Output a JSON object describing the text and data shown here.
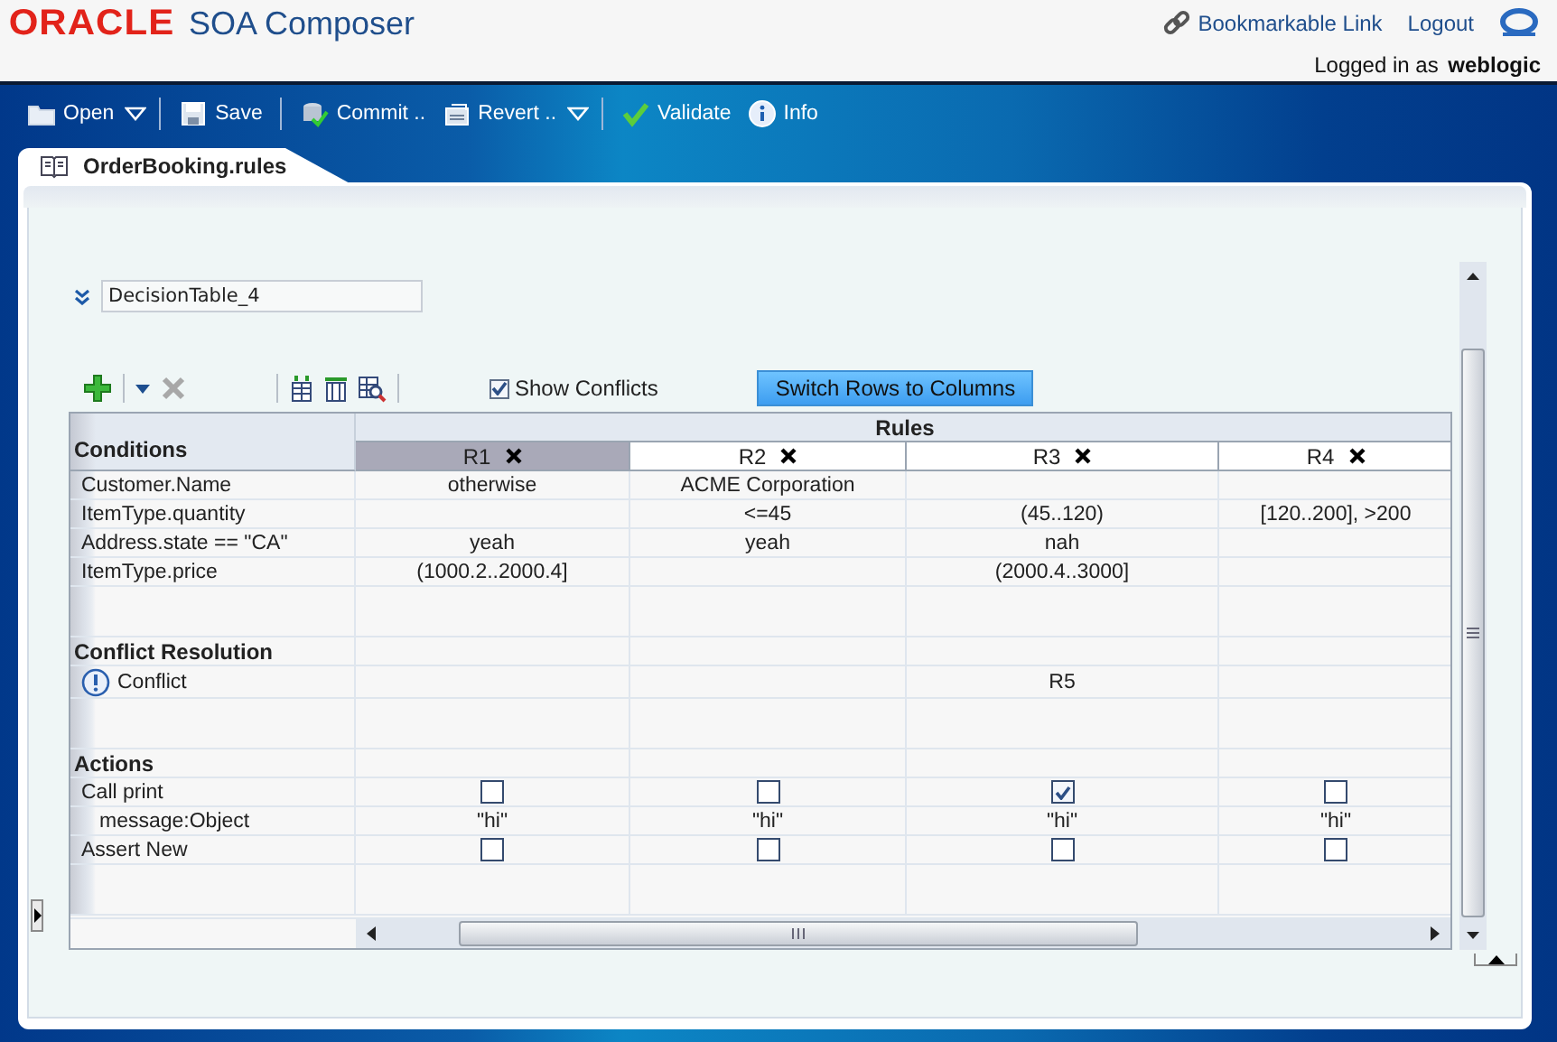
{
  "header": {
    "brand": "ORACLE",
    "product": "SOA Composer",
    "links": [
      {
        "label": "Bookmarkable Link",
        "kind": "bookmark"
      },
      {
        "label": "Logout",
        "kind": "plain"
      }
    ],
    "login": "Logged in as **weblogic**"
  },
  "toolbar": [
    {
      "label": "Open",
      "kind": "open",
      "dropdown": true,
      "separator_after": true
    },
    {
      "label": "Save",
      "kind": "save",
      "dropdown": false,
      "separator_after": true
    },
    {
      "label": "Commit ..",
      "kind": "commit",
      "dropdown": false,
      "separator_after": false
    },
    {
      "label": "Revert ..",
      "kind": "revert",
      "dropdown": true,
      "separator_after": true
    },
    {
      "label": "Validate",
      "kind": "validate",
      "dropdown": false,
      "separator_after": false
    },
    {
      "label": "Info",
      "kind": "info",
      "dropdown": false,
      "separator_after": false
    }
  ],
  "tabs": [
    {
      "label": "OrderBooking.rules",
      "selected": true
    }
  ],
  "decision_table": {
    "name": "DecisionTable_4",
    "show_conflicts": {
      "label": "Show Conflicts",
      "checked": true
    },
    "switch_button": "Switch Rows to Columns",
    "conditions_heading": "Conditions",
    "rules_heading": "Rules",
    "rule_columns": [
      {
        "label": "R1",
        "selected": true
      },
      {
        "label": "R2",
        "selected": false
      },
      {
        "label": "R3",
        "selected": false
      },
      {
        "label": "R4",
        "selected": false
      }
    ],
    "rows": [
      {
        "kind": "value",
        "label": "Customer.Name",
        "cells": [
          "otherwise",
          "ACME Corporation",
          null,
          null
        ]
      },
      {
        "kind": "value",
        "label": "ItemType.quantity",
        "cells": [
          null,
          "<=45",
          "(45..120)",
          "[120..200], >200"
        ]
      },
      {
        "kind": "value",
        "label": "Address.state == \"CA\"",
        "cells": [
          "yeah",
          "yeah",
          "nah",
          null
        ]
      },
      {
        "kind": "value",
        "label": "ItemType.price",
        "cells": [
          "(1000.2..2000.4]",
          null,
          "(2000.4..3000]",
          null
        ]
      },
      {
        "kind": "spacer"
      },
      {
        "kind": "section",
        "label": "Conflict Resolution"
      },
      {
        "kind": "conflict",
        "label": "Conflict",
        "cells": [
          null,
          null,
          "R5",
          null
        ]
      },
      {
        "kind": "spacer"
      },
      {
        "kind": "section",
        "label": "Actions"
      },
      {
        "kind": "check",
        "label": "Call print",
        "checks": [
          false,
          false,
          true,
          false
        ]
      },
      {
        "kind": "param",
        "label": "message:Object",
        "cells": [
          "\"hi\"",
          "\"hi\"",
          "\"hi\"",
          "\"hi\""
        ]
      },
      {
        "kind": "check",
        "label": "Assert New",
        "checks": [
          false,
          false,
          false,
          false
        ]
      },
      {
        "kind": "spacer"
      }
    ]
  }
}
